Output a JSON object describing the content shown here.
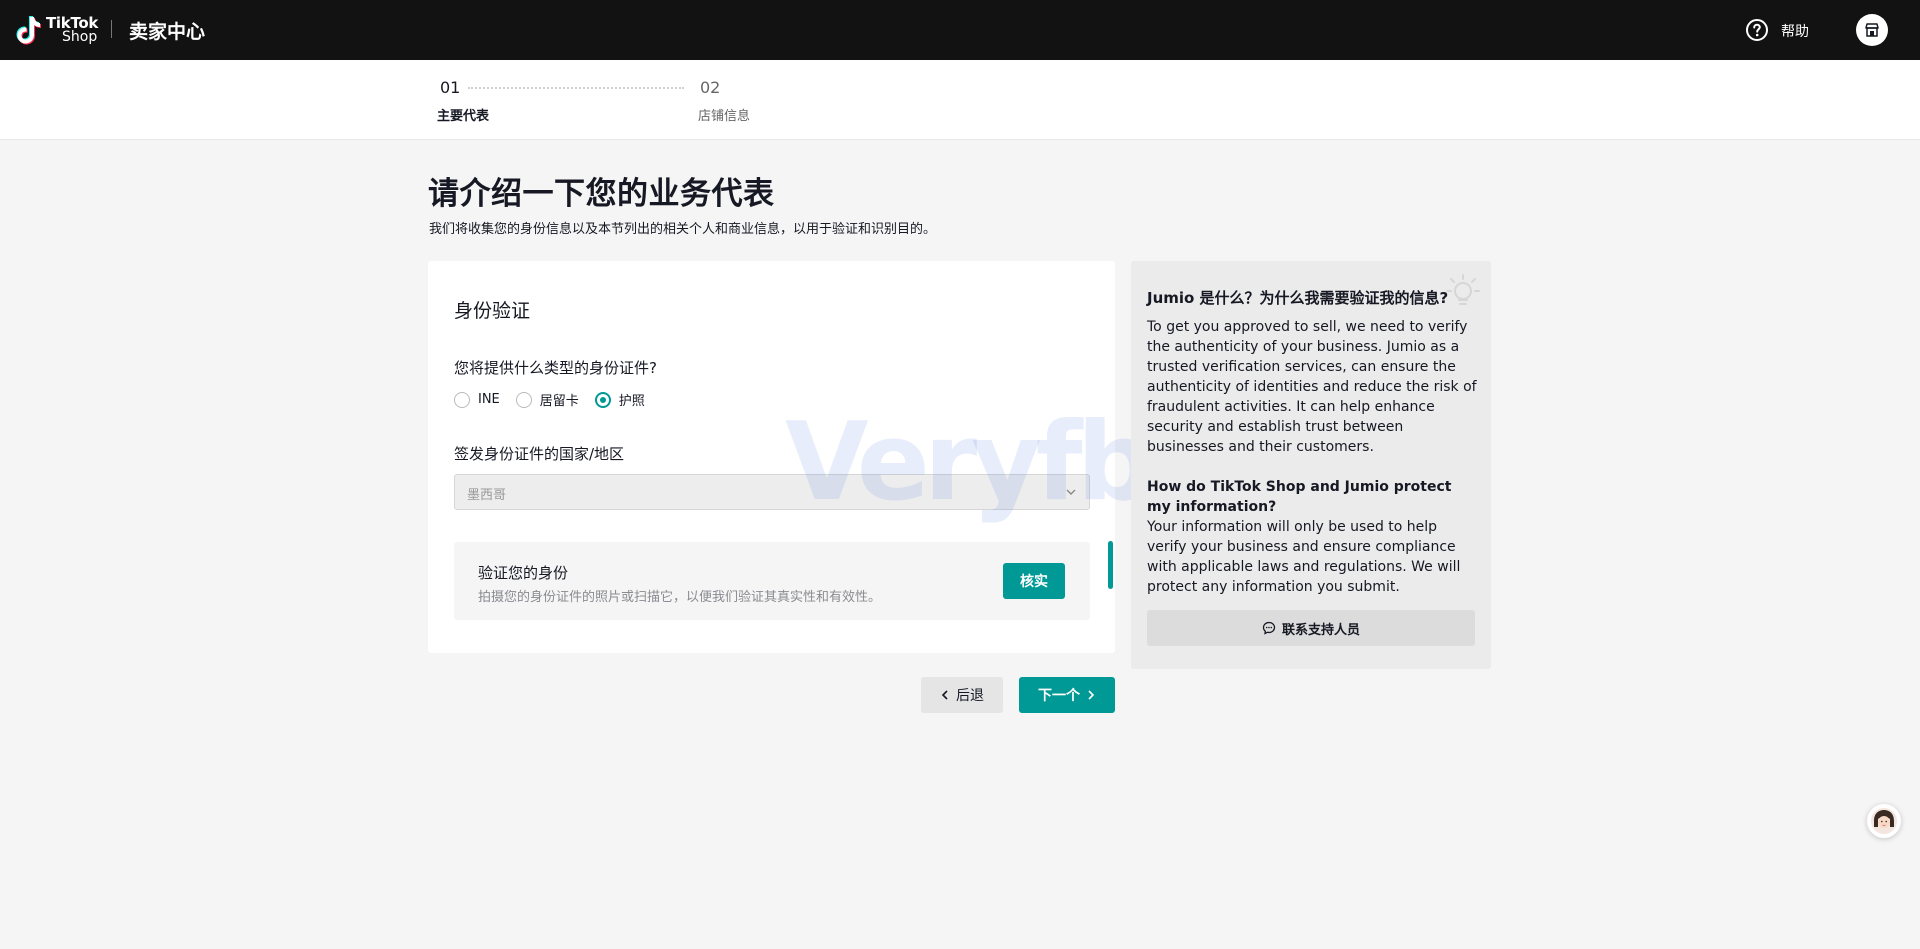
{
  "header": {
    "logo_line1": "TikTok",
    "logo_line2": "Shop",
    "title": "卖家中心",
    "help_label": "帮助",
    "help_icon": "help-circle-icon",
    "shop_icon": "store-icon"
  },
  "stepper": {
    "steps": [
      {
        "num": "01",
        "label": "主要代表",
        "active": true
      },
      {
        "num": "02",
        "label": "店铺信息",
        "active": false
      }
    ]
  },
  "page": {
    "title": "请介绍一下您的业务代表",
    "subtitle": "我们将收集您的身份信息以及本节列出的相关个人和商业信息，以用于验证和识别目的。"
  },
  "form": {
    "section_title": "身份验证",
    "id_type_label": "您将提供什么类型的身份证件?",
    "id_types": [
      {
        "label": "INE",
        "checked": false
      },
      {
        "label": "居留卡",
        "checked": false
      },
      {
        "label": "护照",
        "checked": true
      }
    ],
    "country_label": "签发身份证件的国家/地区",
    "country_value": "墨西哥",
    "verify": {
      "title": "验证您的身份",
      "description": "拍摄您的身份证件的照片或扫描它，以便我们验证其真实性和有效性。",
      "button": "核实"
    }
  },
  "nav": {
    "back_label": "后退",
    "next_label": "下一个"
  },
  "side_panel": {
    "title": "Jumio 是什么？为什么我需要验证我的信息?",
    "paragraph1": "To get you approved to sell, we need to verify the authenticity of your business. Jumio as a trusted verification services, can ensure the authenticity of identities and reduce the risk of fraudulent activities. It can help enhance security and establish trust between businesses and their customers.",
    "heading2": "How do TikTok Shop and Jumio protect my information?",
    "paragraph2": "Your information will only be used to help verify your business and ensure compliance with applicable laws and regulations. We will protect any information you submit.",
    "support_button": "联系支持人员"
  },
  "watermark": "Veryfb",
  "colors": {
    "accent": "#009995",
    "topbar": "#121212",
    "background": "#f5f5f5"
  }
}
